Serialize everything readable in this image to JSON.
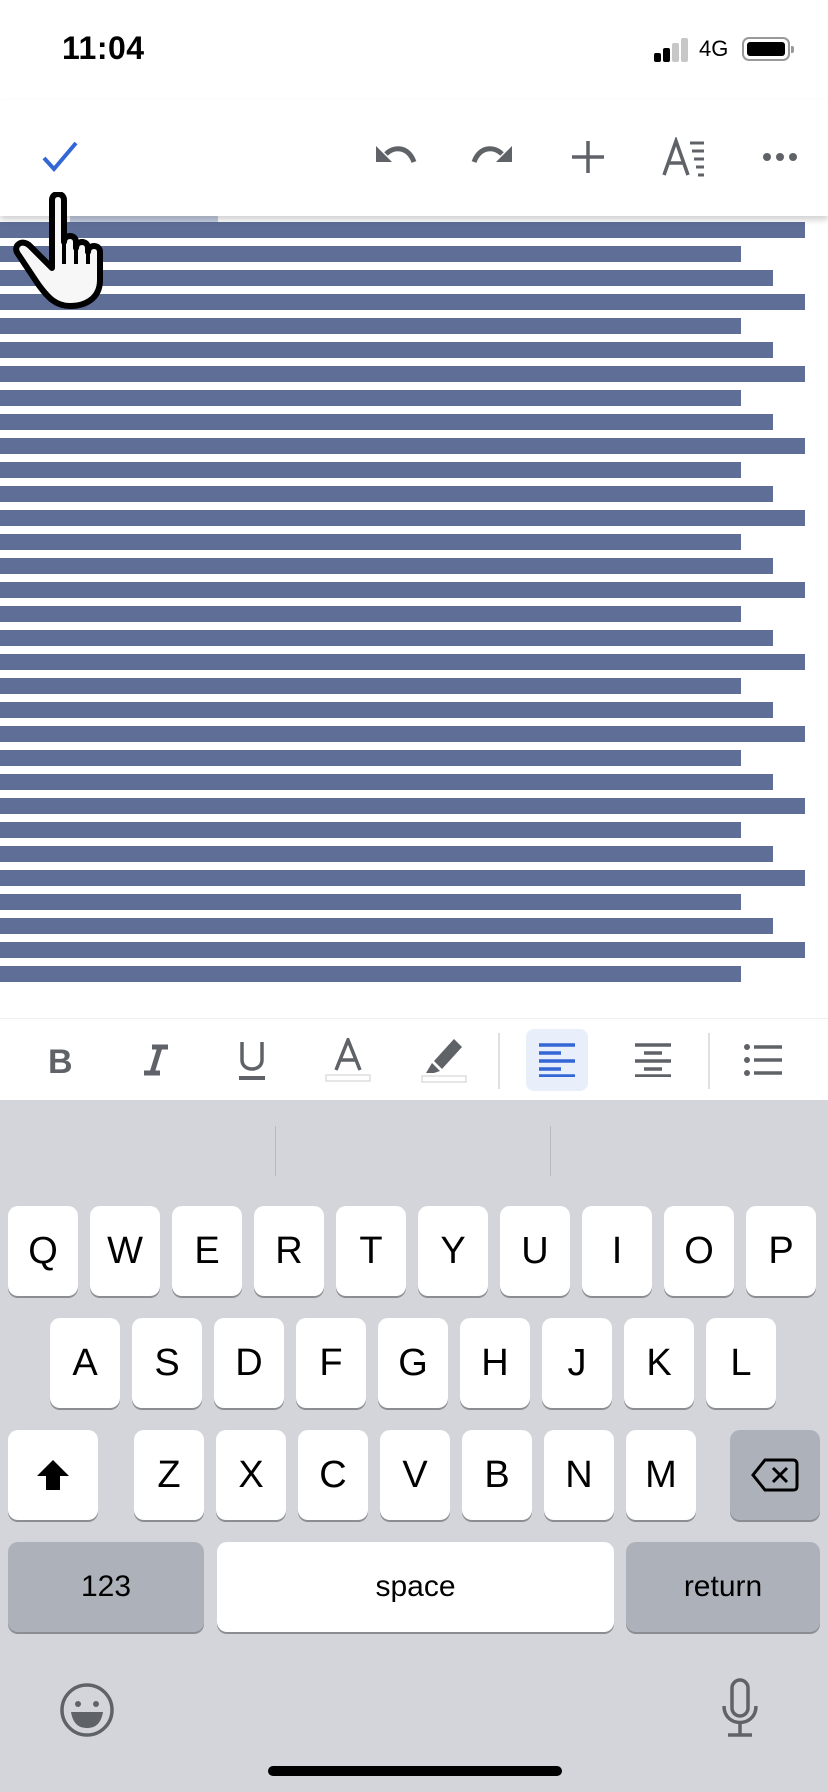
{
  "status_bar": {
    "time": "11:04",
    "network": "4G",
    "signal_bars_active": 2,
    "signal_bars_total": 4,
    "battery_level": 0.9
  },
  "toolbar": {
    "done_icon": "checkmark-icon",
    "icons": [
      "undo-icon",
      "redo-icon",
      "insert-plus-icon",
      "text-format-icon",
      "more-options-icon"
    ],
    "accent_color": "#3367d6",
    "icon_color": "#5f6368"
  },
  "document": {
    "title_partial": "",
    "bar_color": "#5e6e97",
    "line_count": 32,
    "line_width_pattern": [
      1.0,
      0.92,
      0.96
    ]
  },
  "format_bar": {
    "items": [
      "bold",
      "italic",
      "underline",
      "text-color",
      "highlight",
      "align-left",
      "align-center",
      "bulleted-list"
    ],
    "active": "align-left"
  },
  "keyboard": {
    "row1": [
      "Q",
      "W",
      "E",
      "R",
      "T",
      "Y",
      "U",
      "I",
      "O",
      "P"
    ],
    "row2": [
      "A",
      "S",
      "D",
      "F",
      "G",
      "H",
      "J",
      "K",
      "L"
    ],
    "row3": [
      "Z",
      "X",
      "C",
      "V",
      "B",
      "N",
      "M"
    ],
    "numbers_label": "123",
    "space_label": "space",
    "return_label": "return"
  }
}
